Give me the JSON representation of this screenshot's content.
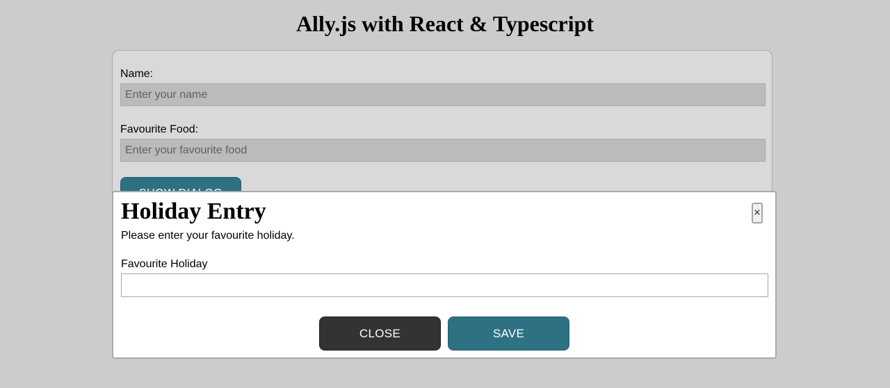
{
  "page": {
    "title": "Ally.js with React & Typescript"
  },
  "form": {
    "name_label": "Name:",
    "name_placeholder": "Enter your name",
    "name_value": "",
    "food_label": "Favourite Food:",
    "food_placeholder": "Enter your favourite food",
    "food_value": "",
    "show_dialog_label": "SHOW DIALOG"
  },
  "dialog": {
    "title": "Holiday Entry",
    "close_icon": "×",
    "description": "Please enter your favourite holiday.",
    "holiday_label": "Favourite Holiday",
    "holiday_value": "",
    "close_label": "CLOSE",
    "save_label": "SAVE"
  },
  "colors": {
    "background": "#cbccce",
    "card": "#d9d9d9",
    "input_fill": "#bbbbbb",
    "primary": "#2d7183",
    "dark": "#333333",
    "dialog": "#ffffff"
  }
}
